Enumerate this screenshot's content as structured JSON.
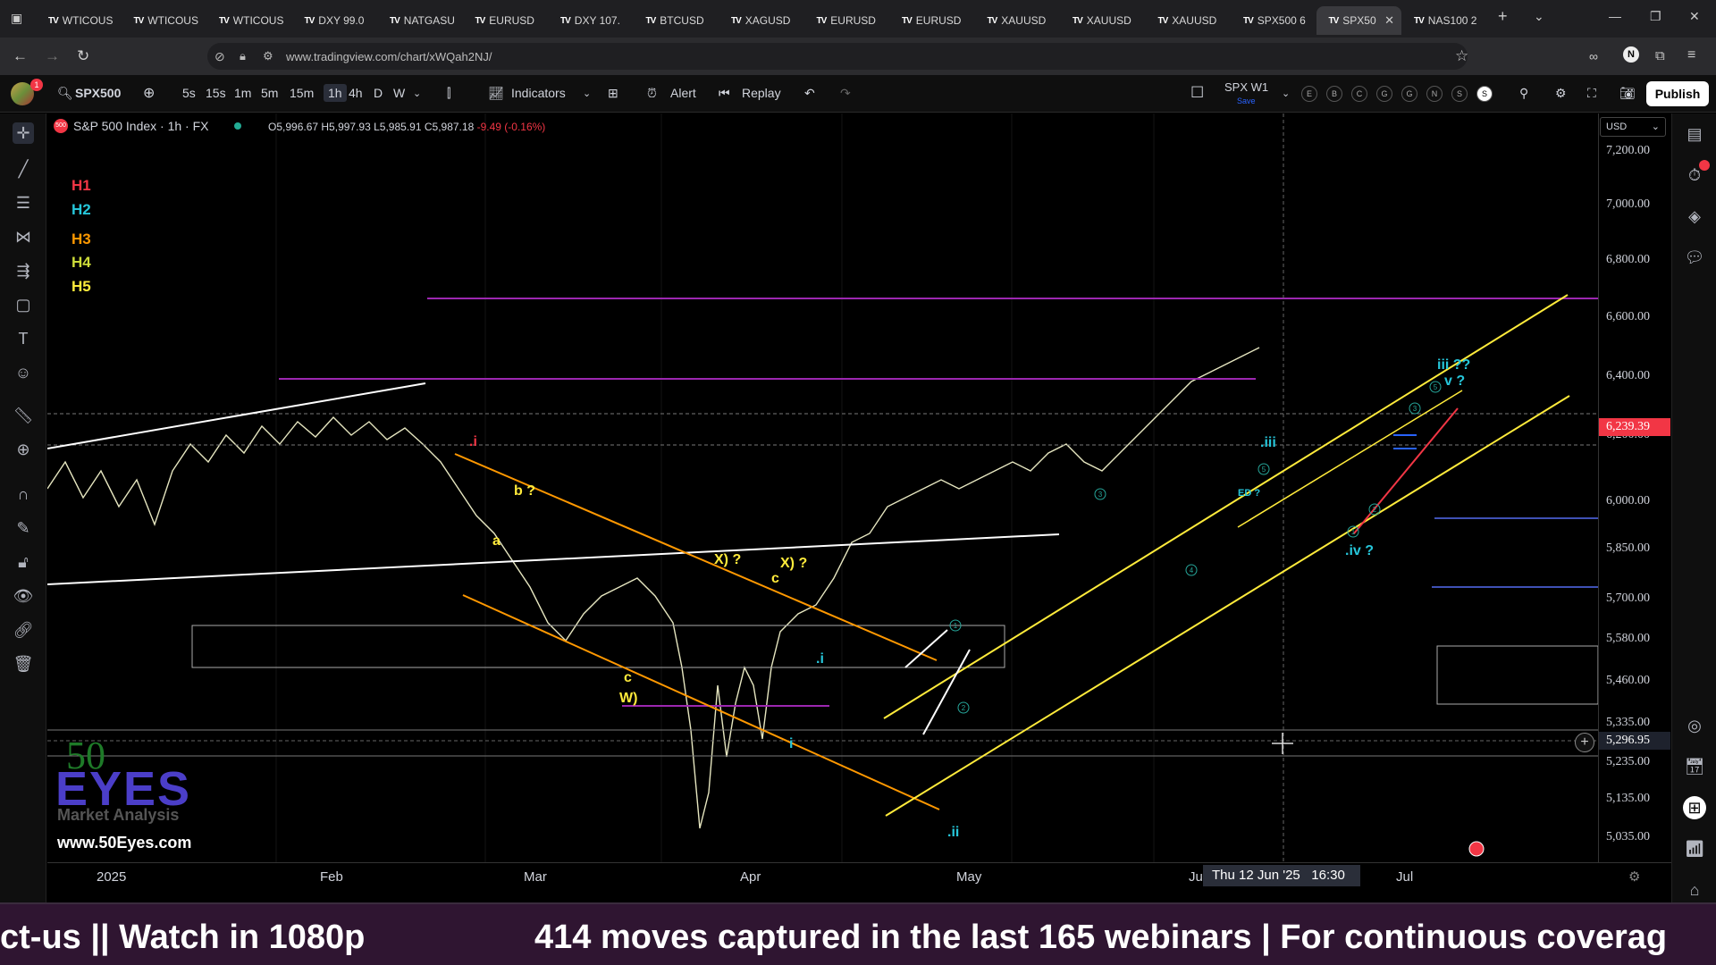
{
  "browser": {
    "tabs": [
      {
        "label": "WTICOUS"
      },
      {
        "label": "WTICOUS"
      },
      {
        "label": "WTICOUS"
      },
      {
        "label": "DXY 99.0"
      },
      {
        "label": "NATGASU"
      },
      {
        "label": "EURUSD"
      },
      {
        "label": "DXY 107."
      },
      {
        "label": "BTCUSD"
      },
      {
        "label": "XAGUSD"
      },
      {
        "label": "EURUSD"
      },
      {
        "label": "EURUSD"
      },
      {
        "label": "XAUUSD"
      },
      {
        "label": "XAUUSD"
      },
      {
        "label": "XAUUSD"
      },
      {
        "label": "SPX500 6"
      },
      {
        "label": "SPX50",
        "active": true
      },
      {
        "label": "NAS100 2"
      }
    ],
    "url": "www.tradingview.com/chart/xWQah2NJ/"
  },
  "toolbar": {
    "symbol": "SPX500",
    "timeframes": [
      "5s",
      "15s",
      "1m",
      "5m",
      "15m",
      "1h",
      "4h",
      "D",
      "W"
    ],
    "active_timeframe": "1h",
    "indicators_label": "Indicators",
    "alert_label": "Alert",
    "replay_label": "Replay",
    "layout_name": "SPX W1",
    "layout_sub": "Save",
    "letter_buttons": [
      "E",
      "B",
      "C",
      "G",
      "G",
      "N",
      "S",
      "S"
    ],
    "publish_label": "Publish",
    "avatar_badge": "1"
  },
  "legend": {
    "title": "S&P 500 Index · 1h · FX",
    "o": "O5,996.67",
    "h": "H5,997.93",
    "l": "L5,985.91",
    "c": "C5,987.18",
    "chg": "-9.49 (-0.16%)"
  },
  "hlabels": [
    {
      "text": "H1",
      "color": "#f23645"
    },
    {
      "text": "H2",
      "color": "#26c6da"
    },
    {
      "text": "H3",
      "color": "#ff9800"
    },
    {
      "text": "H4",
      "color": "#cddc39"
    },
    {
      "text": "H5",
      "color": "#ffeb3b"
    }
  ],
  "currency": "USD",
  "price_ticks": [
    "7,200.00",
    "7,000.00",
    "6,800.00",
    "6,600.00",
    "6,400.00",
    "6,200.00",
    "6,000.00",
    "5,850.00",
    "5,700.00",
    "5,580.00",
    "5,460.00",
    "5,335.00",
    "5,235.00",
    "5,135.00",
    "5,035.00"
  ],
  "price_tags": [
    {
      "text": "6,239.39",
      "bg": "#f23645",
      "fg": "#ffffff"
    },
    {
      "text": "5,296.95",
      "bg": "#1e222d",
      "fg": "#ffffff"
    }
  ],
  "time_labels": [
    "2025",
    "Feb",
    "Mar",
    "Apr",
    "May",
    "Jun",
    "Jul"
  ],
  "crosshair_time": "Thu 12 Jun '25   16:30",
  "wave_labels": [
    {
      "text": ".i",
      "color": "#f23645"
    },
    {
      "text": "b ?",
      "color": "#ffeb3b"
    },
    {
      "text": "a",
      "color": "#ffeb3b"
    },
    {
      "text": "c",
      "color": "#ffeb3b"
    },
    {
      "text": "W)",
      "color": "#ffeb3b"
    },
    {
      "text": "X) ?",
      "color": "#ffeb3b"
    },
    {
      "text": "X) ?",
      "color": "#ffeb3b"
    },
    {
      "text": "c",
      "color": "#ffeb3b"
    },
    {
      "text": ".i",
      "color": "#26c6da"
    },
    {
      "text": "i",
      "color": "#26c6da"
    },
    {
      "text": ".ii",
      "color": "#26c6da"
    },
    {
      "text": ".iii",
      "color": "#26c6da"
    },
    {
      "text": "ED ?",
      "color": "#26c6da"
    },
    {
      "text": ".iv ?",
      "color": "#26c6da"
    },
    {
      "text": "iii ??",
      "color": "#26c6da"
    },
    {
      "text": "v ?",
      "color": "#26c6da"
    }
  ],
  "circled_labels": [
    "1",
    "2",
    "3",
    "4",
    "5",
    "1",
    "2",
    "3",
    "5"
  ],
  "watermark": {
    "fifty": "50",
    "eyes": "EYES",
    "sub": "Market Analysis",
    "url": "www.50Eyes.com"
  },
  "ticker": [
    "ct-us || Watch in 1080p",
    "414 moves captured in the last 165 webinars | For continuous coverag"
  ]
}
